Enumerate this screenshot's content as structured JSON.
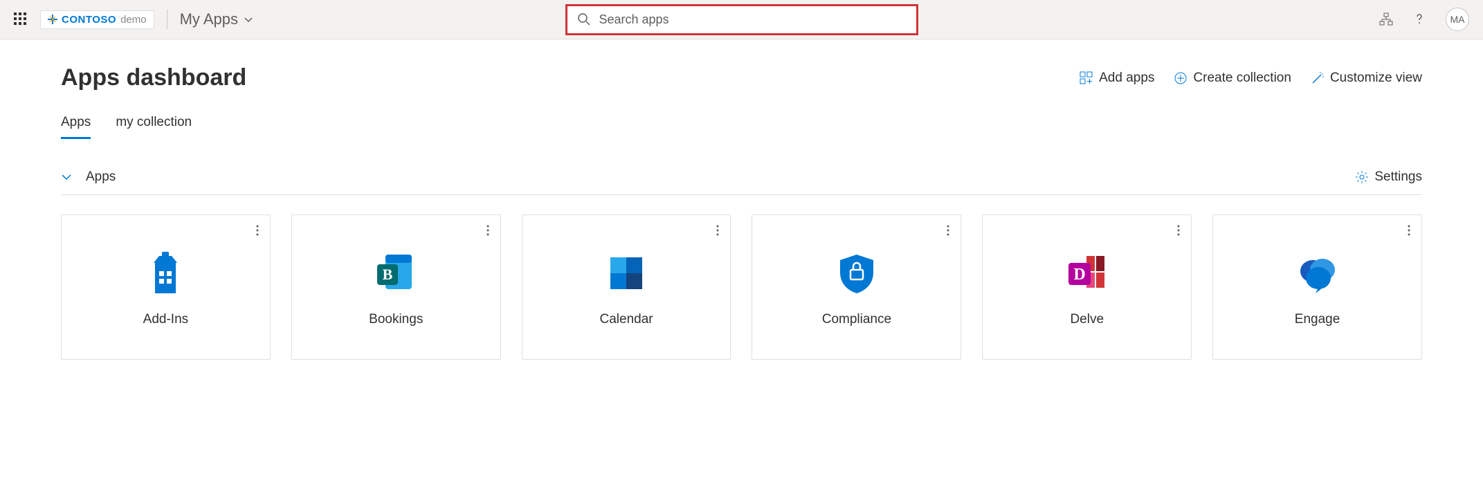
{
  "header": {
    "logo_brand": "CONTOSO",
    "logo_suffix": "demo",
    "app_switcher_label": "My Apps",
    "search_placeholder": "Search apps",
    "avatar_initials": "MA"
  },
  "dashboard": {
    "title": "Apps dashboard",
    "actions": {
      "add_apps": "Add apps",
      "create_collection": "Create collection",
      "customize_view": "Customize view"
    }
  },
  "tabs": [
    {
      "label": "Apps",
      "active": true
    },
    {
      "label": "my collection",
      "active": false
    }
  ],
  "section": {
    "title": "Apps",
    "settings_label": "Settings"
  },
  "apps": [
    {
      "name": "Add-Ins",
      "icon": "addins"
    },
    {
      "name": "Bookings",
      "icon": "bookings"
    },
    {
      "name": "Calendar",
      "icon": "calendar"
    },
    {
      "name": "Compliance",
      "icon": "compliance"
    },
    {
      "name": "Delve",
      "icon": "delve"
    },
    {
      "name": "Engage",
      "icon": "engage"
    }
  ],
  "colors": {
    "accent": "#0078d4",
    "highlight_border": "#d13438"
  }
}
